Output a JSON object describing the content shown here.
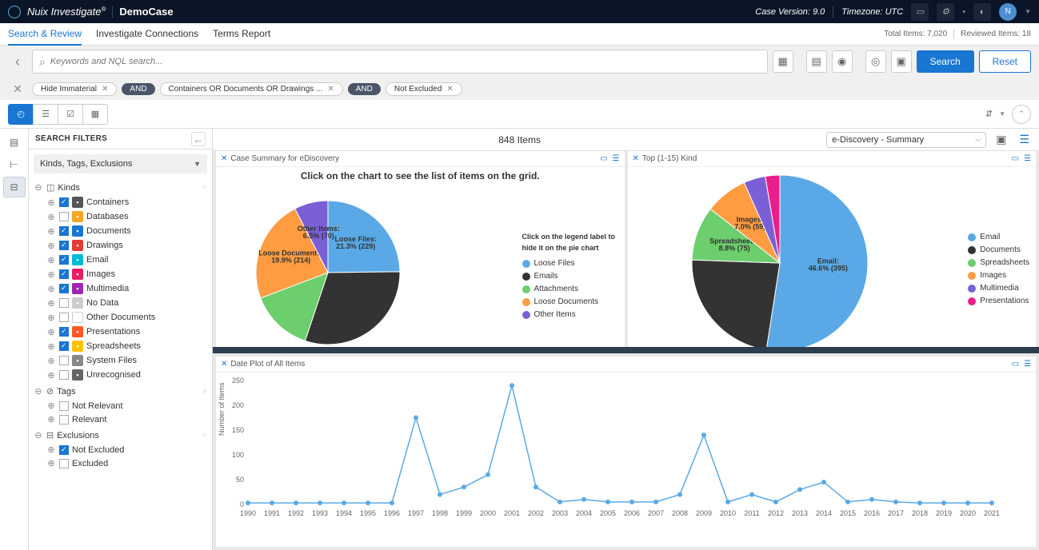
{
  "header": {
    "app": "Nuix Investigate",
    "case": "DemoCase",
    "caseVersion": "Case Version: 9.0",
    "timezone": "Timezone: UTC",
    "avatar": "N"
  },
  "tabs": {
    "items": [
      "Search & Review",
      "Investigate Connections",
      "Terms Report"
    ],
    "activeIndex": 0,
    "totalItems": "Total Items: 7,020",
    "reviewedItems": "Reviewed Items: 18"
  },
  "search": {
    "placeholder": "Keywords and NQL search...",
    "searchBtn": "Search",
    "resetBtn": "Reset"
  },
  "pills": {
    "p1": "Hide Immaterial",
    "and": "AND",
    "p2": "Containers OR Documents OR Drawings ...",
    "p3": "Not Excluded"
  },
  "sidebar": {
    "title": "SEARCH FILTERS",
    "dropdown": "Kinds, Tags, Exclusions",
    "sections": {
      "kinds": {
        "label": "Kinds",
        "items": [
          {
            "label": "Containers",
            "checked": true,
            "color": "#555"
          },
          {
            "label": "Databases",
            "checked": false,
            "color": "#f5a623"
          },
          {
            "label": "Documents",
            "checked": true,
            "color": "#1976d2"
          },
          {
            "label": "Drawings",
            "checked": true,
            "color": "#e53935"
          },
          {
            "label": "Email",
            "checked": true,
            "color": "#00bcd4"
          },
          {
            "label": "Images",
            "checked": true,
            "color": "#e91e63"
          },
          {
            "label": "Multimedia",
            "checked": true,
            "color": "#9c27b0"
          },
          {
            "label": "No Data",
            "checked": false,
            "color": "#ccc"
          },
          {
            "label": "Other Documents",
            "checked": false,
            "color": "#fff"
          },
          {
            "label": "Presentations",
            "checked": true,
            "color": "#ff5722"
          },
          {
            "label": "Spreadsheets",
            "checked": true,
            "color": "#ffc107"
          },
          {
            "label": "System Files",
            "checked": false,
            "color": "#888"
          },
          {
            "label": "Unrecognised",
            "checked": false,
            "color": "#666"
          }
        ]
      },
      "tags": {
        "label": "Tags",
        "items": [
          {
            "label": "Not Relevant",
            "checked": false
          },
          {
            "label": "Relevant",
            "checked": false
          }
        ]
      },
      "exclusions": {
        "label": "Exclusions",
        "items": [
          {
            "label": "Not Excluded",
            "checked": true
          },
          {
            "label": "Excluded",
            "checked": false
          }
        ]
      }
    }
  },
  "results": {
    "count": "848 Items",
    "dropdown": "e-Discovery - Summary"
  },
  "panel1": {
    "title": "Case Summary for eDiscovery",
    "chartTitle": "Click on the chart to see the list of items on the grid.",
    "legendTitle": "Click on the legend label to hide it on the pie chart",
    "slices": [
      {
        "label": "Loose Files",
        "pct": "21.3% (229)",
        "color": "#5aa9e6"
      },
      {
        "label": "Emails",
        "pct": "",
        "color": "#333333"
      },
      {
        "label": "Attachments",
        "pct": "",
        "color": "#6cce6c"
      },
      {
        "label": "Loose Documents",
        "pct": "19.9% (214)",
        "color": "#ff9c42"
      },
      {
        "label": "Other Items",
        "pct": "6.5% (70)",
        "color": "#7b5fd6"
      }
    ]
  },
  "panel2": {
    "title": "Top (1-15) Kind",
    "slices": [
      {
        "label": "Email",
        "pct": "46.6% (395)",
        "color": "#5aa9e6"
      },
      {
        "label": "Documents",
        "pct": "",
        "color": "#333333"
      },
      {
        "label": "Spreadsheets",
        "pct": "8.8% (75)",
        "color": "#6cce6c"
      },
      {
        "label": "Images",
        "pct": "7.0% (59)",
        "color": "#ff9c42"
      },
      {
        "label": "Multimedia",
        "pct": "",
        "color": "#7b5fd6"
      },
      {
        "label": "Presentations",
        "pct": "",
        "color": "#e91e8a"
      }
    ]
  },
  "panel3": {
    "title": "Date Plot of All Items",
    "ylabel": "Number of Items"
  },
  "chart_data": [
    {
      "type": "pie",
      "title": "Case Summary for eDiscovery",
      "series": [
        {
          "name": "Loose Files",
          "value": 229,
          "pct": 21.3
        },
        {
          "name": "Emails",
          "value": 280,
          "pct": 26.0
        },
        {
          "name": "Attachments",
          "value": 130,
          "pct": 12.1
        },
        {
          "name": "Loose Documents",
          "value": 214,
          "pct": 19.9
        },
        {
          "name": "Other Items",
          "value": 70,
          "pct": 6.5
        }
      ]
    },
    {
      "type": "pie",
      "title": "Top (1-15) Kind",
      "series": [
        {
          "name": "Email",
          "value": 395,
          "pct": 46.6
        },
        {
          "name": "Documents",
          "value": 174,
          "pct": 20.5
        },
        {
          "name": "Spreadsheets",
          "value": 75,
          "pct": 8.8
        },
        {
          "name": "Images",
          "value": 59,
          "pct": 7.0
        },
        {
          "name": "Multimedia",
          "value": 30,
          "pct": 3.5
        },
        {
          "name": "Presentations",
          "value": 20,
          "pct": 2.4
        }
      ]
    },
    {
      "type": "line",
      "title": "Date Plot of All Items",
      "xlabel": "",
      "ylabel": "Number of Items",
      "ylim": [
        0,
        250
      ],
      "x": [
        1990,
        1991,
        1992,
        1993,
        1994,
        1995,
        1996,
        1997,
        1998,
        1999,
        2000,
        2001,
        2002,
        2003,
        2004,
        2005,
        2006,
        2007,
        2008,
        2009,
        2010,
        2011,
        2012,
        2013,
        2014,
        2015,
        2016,
        2017,
        2018,
        2019,
        2020,
        2021
      ],
      "values": [
        3,
        3,
        3,
        3,
        3,
        3,
        3,
        175,
        20,
        35,
        60,
        240,
        35,
        5,
        10,
        5,
        5,
        5,
        20,
        140,
        5,
        20,
        5,
        30,
        45,
        5,
        10,
        5,
        3,
        3,
        3,
        3
      ]
    }
  ]
}
